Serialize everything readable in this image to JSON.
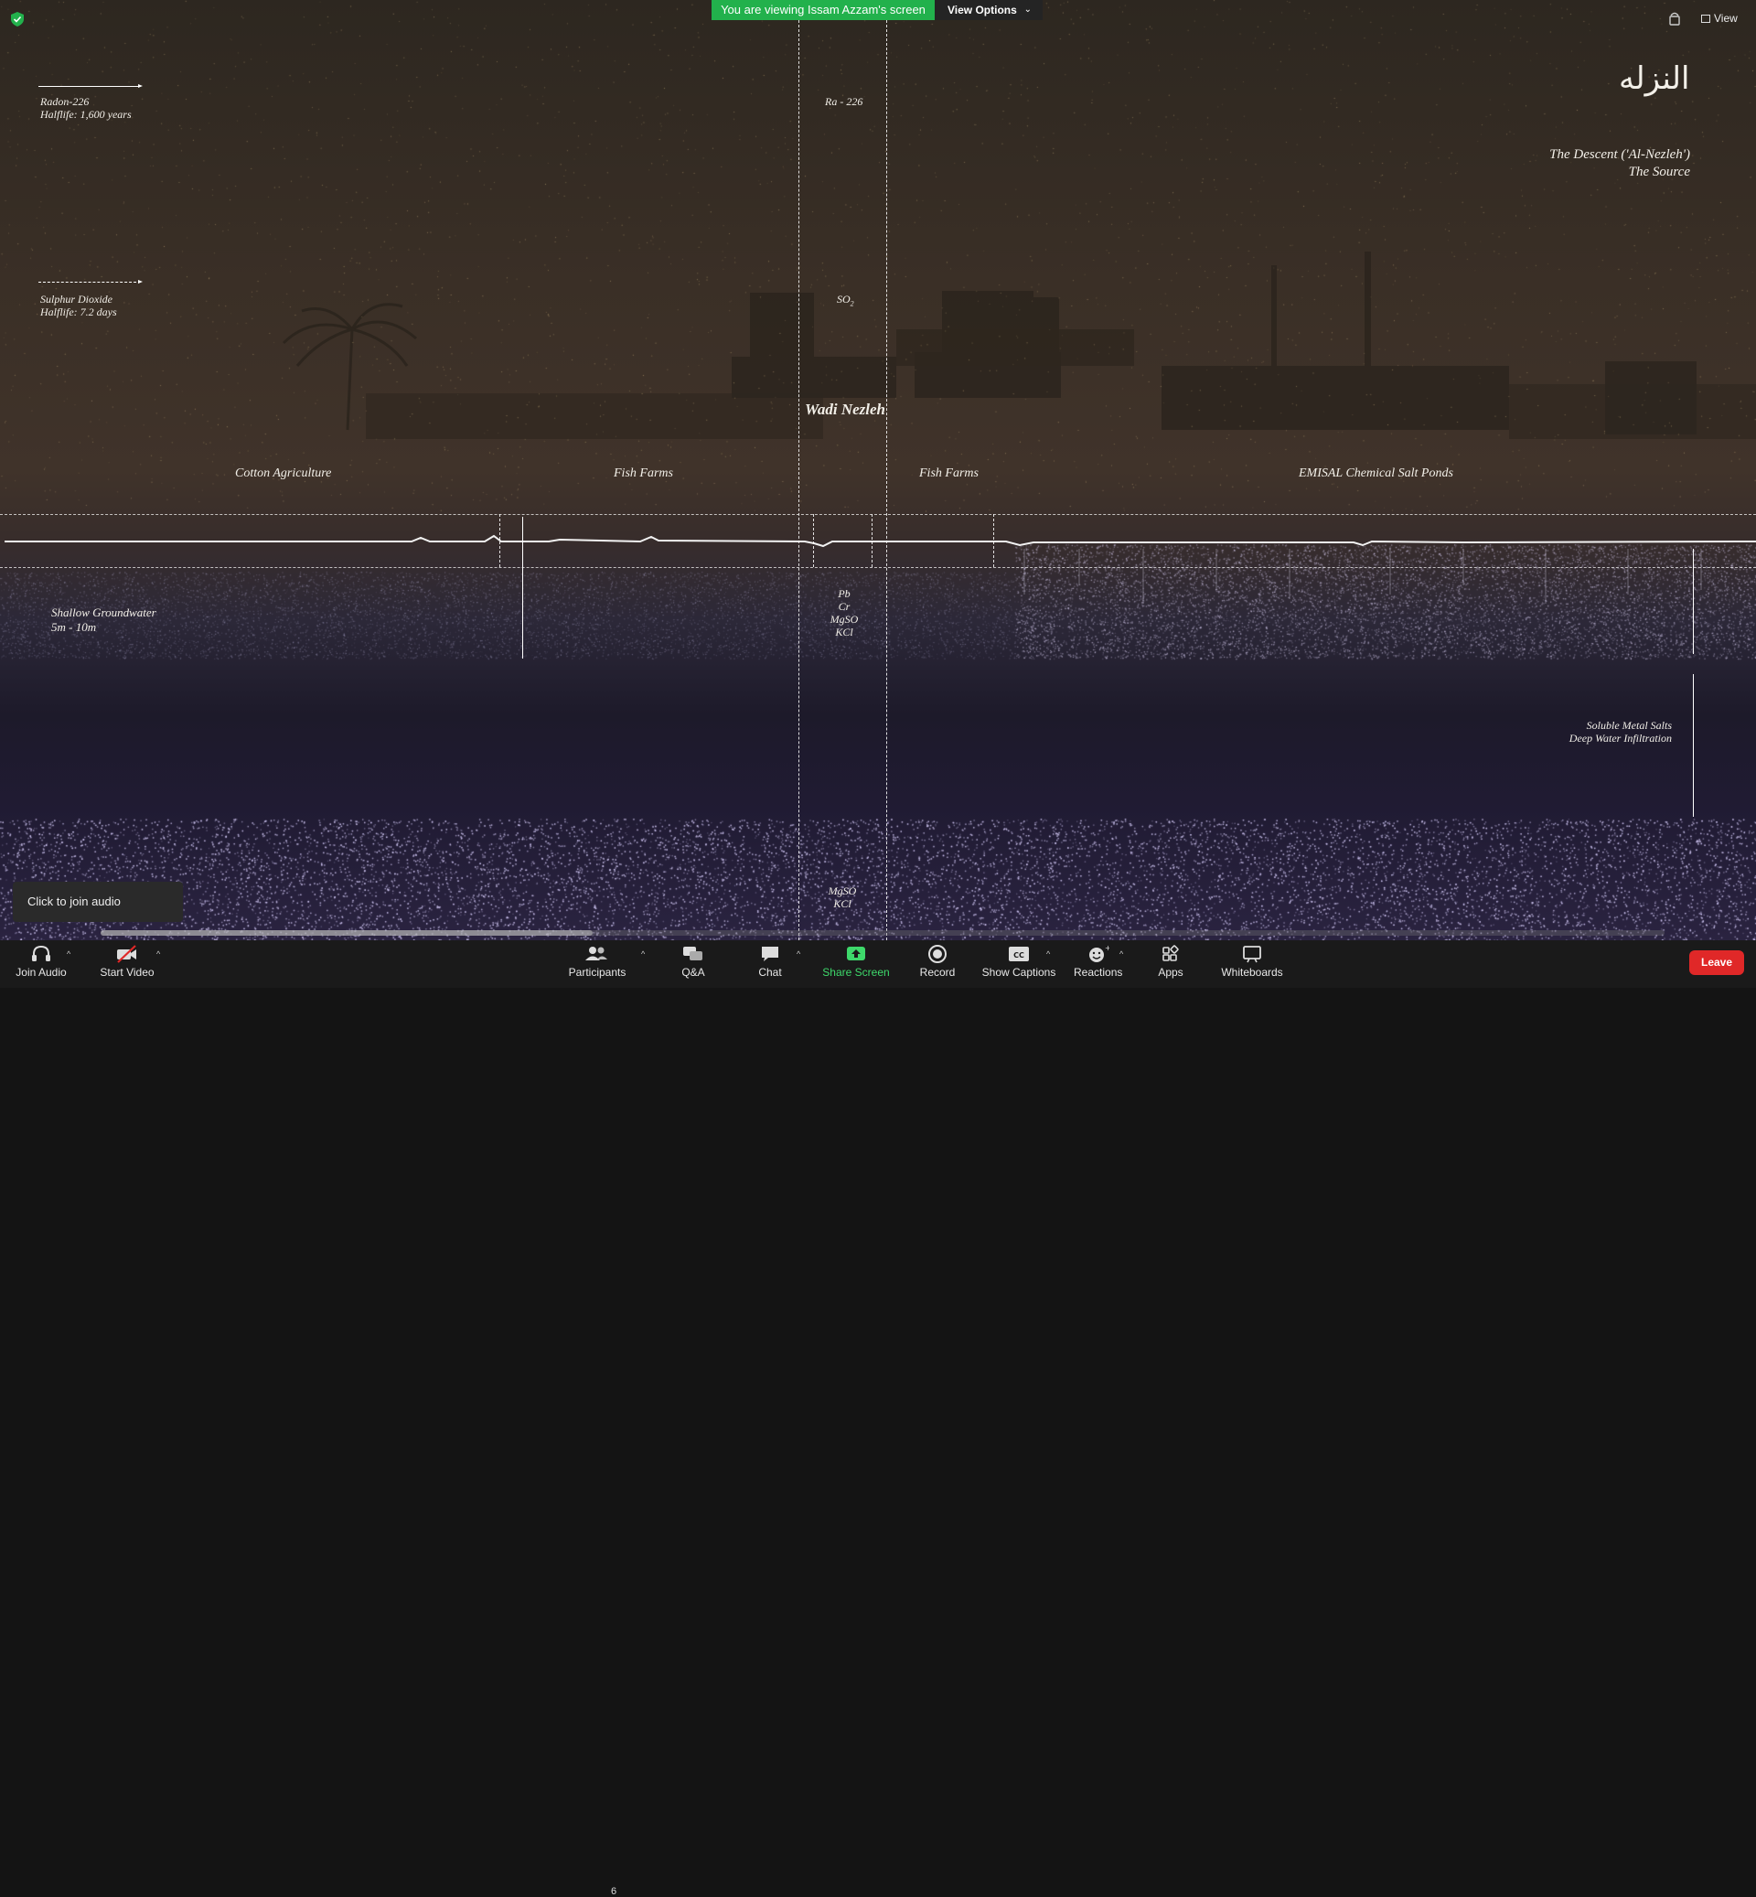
{
  "notification": {
    "viewing_text": "You are viewing Issam Azzam's screen",
    "view_options_label": "View Options"
  },
  "top_right": {
    "view_label": "View"
  },
  "slide": {
    "title_arabic": "النزله",
    "subtitle_line1": "The Descent ('Al-Nezleh')",
    "subtitle_line2": "The Source",
    "radon_line1": "Radon-226",
    "radon_line2": "Halflife: 1,600 years",
    "sulphur_line1": "Sulphur Dioxide",
    "sulphur_line2": "Halflife: 7.2 days",
    "ra226": "Ra - 226",
    "so2": "SO",
    "so2_sub": "2",
    "wadi": "Wadi Nezleh",
    "zones": [
      "Cotton Agriculture",
      "Fish Farms",
      "Fish Farms",
      "EMISAL Chemical Salt Ponds"
    ],
    "groundwater_line1": "Shallow Groundwater",
    "groundwater_line2": "5m - 10m",
    "metals": [
      "Pb",
      "Cr",
      "MgSO",
      "KCl"
    ],
    "soluble_line1": "Soluble Metal Salts",
    "soluble_line2": "Deep Water Infiltration",
    "bottom_salts": [
      "MgSO",
      "KCl"
    ]
  },
  "audio_tip": "Click to join audio",
  "toolbar": {
    "join_audio": "Join Audio",
    "start_video": "Start Video",
    "participants": "Participants",
    "participants_count": "6",
    "qa": "Q&A",
    "chat": "Chat",
    "share_screen": "Share Screen",
    "record": "Record",
    "show_captions": "Show Captions",
    "cc": "CC",
    "reactions": "Reactions",
    "apps": "Apps",
    "whiteboards": "Whiteboards",
    "leave": "Leave"
  },
  "colors": {
    "notification_green": "#22b14c",
    "share_green": "#3ed96b",
    "leave_red": "#e02828",
    "toolbar_bg": "#1a1a1a"
  }
}
